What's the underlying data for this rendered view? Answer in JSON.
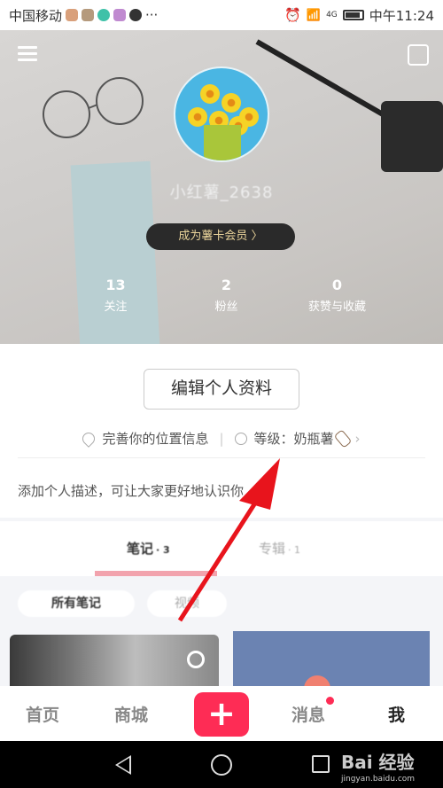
{
  "status_bar": {
    "carrier": "中国移动",
    "more": "···",
    "network": "4G",
    "time": "中午11:24",
    "notification_icons": [
      "app-icon-1",
      "tiktok-icon",
      "app-icon-3",
      "app-icon-4",
      "chat-bubble-icon"
    ]
  },
  "profile": {
    "username": "小红薯_2638",
    "vip_label": "成为薯卡会员 〉",
    "stats": [
      {
        "value": "13",
        "label": "关注"
      },
      {
        "value": "2",
        "label": "粉丝"
      },
      {
        "value": "0",
        "label": "获赞与收藏"
      }
    ],
    "edit_button": "编辑个人资料",
    "location": "完善你的位置信息",
    "level": "等级：奶瓶薯",
    "description_placeholder": "添加个人描述，可让大家更好地认识你"
  },
  "tabs": [
    {
      "label": "笔记",
      "count": "· 3",
      "active": true
    },
    {
      "label": "专辑",
      "count": "· 1",
      "active": false
    }
  ],
  "filters": [
    {
      "label": "所有笔记",
      "active": true
    },
    {
      "label": "视频",
      "active": false
    }
  ],
  "bottom_nav": {
    "home": "首页",
    "shop": "商城",
    "plus": "+",
    "messages": "消息",
    "me": "我"
  },
  "watermark": {
    "brand": "Bai  经验",
    "url": "jingyan.baidu.com"
  },
  "colors": {
    "accent": "#fe2c55",
    "annotation_arrow": "#e8141c"
  }
}
